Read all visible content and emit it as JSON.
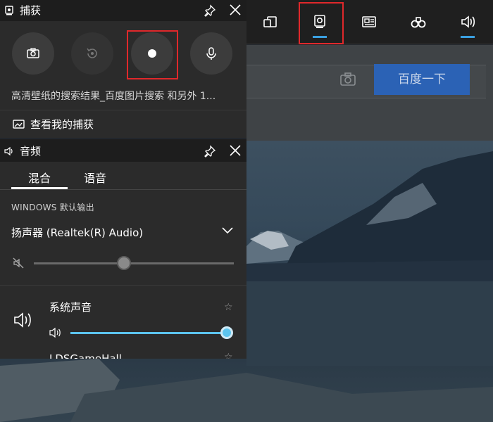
{
  "capture_widget": {
    "title": "捕获",
    "caption": "高清壁纸的搜索结果_百度图片搜索 和另外 1...",
    "view_captures": "查看我的捕获",
    "icons": [
      "screenshot-icon",
      "record-last-icon",
      "record-icon",
      "microphone-icon"
    ]
  },
  "audio_widget": {
    "title": "音频",
    "tabs": [
      {
        "label": "混合",
        "active": true
      },
      {
        "label": "语音",
        "active": false
      }
    ],
    "section_label": "WINDOWS 默认输出",
    "device": "扬声器 (Realtek(R) Audio)",
    "master_volume": 0.45,
    "apps": [
      {
        "name": "系统声音",
        "volume": 1.0
      },
      {
        "name": "LDSGameHall",
        "volume": null
      }
    ]
  },
  "toolbar": {
    "items": [
      "performance-icon",
      "capture-icon",
      "gallery-icon",
      "xbox-social-icon",
      "audio-icon"
    ],
    "active": [
      "capture-icon",
      "audio-icon"
    ]
  },
  "browser": {
    "search_button": "百度一下"
  },
  "colors": {
    "accent": "#5cc4ee",
    "highlight": "#e0282b",
    "panel": "#2b2b2b"
  }
}
